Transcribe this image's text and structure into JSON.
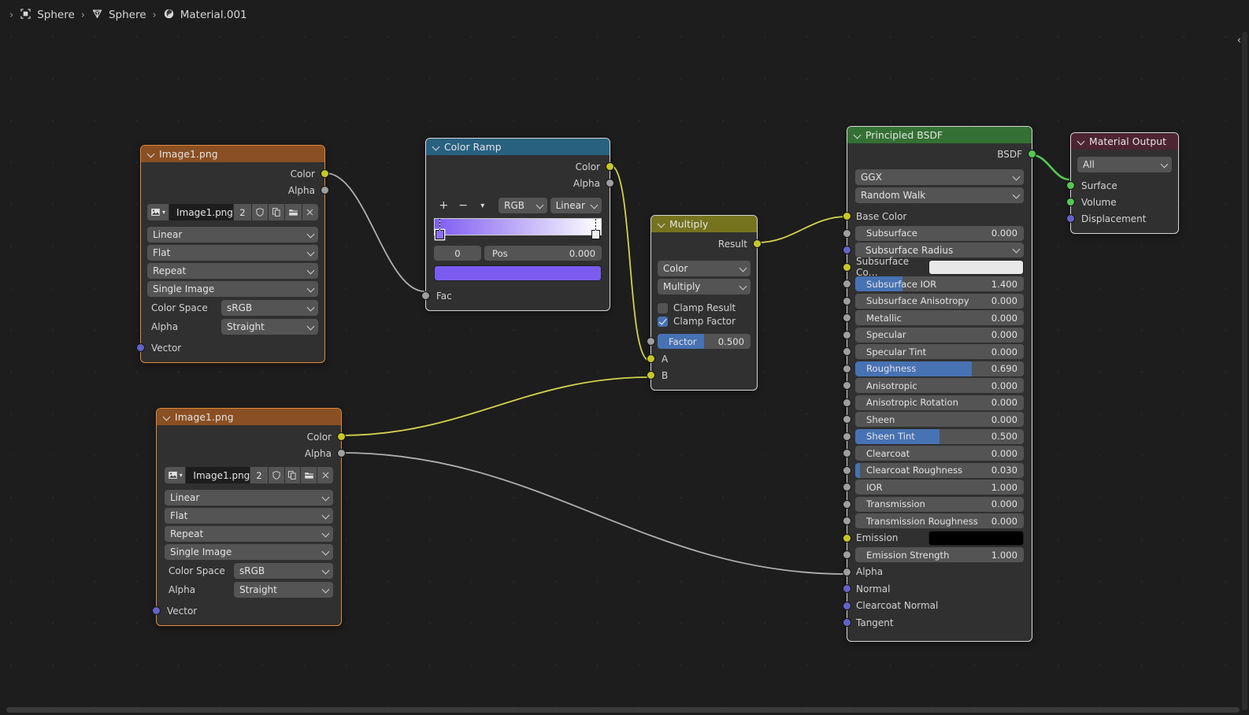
{
  "breadcrumb": {
    "items": [
      {
        "icon": "object-icon",
        "label": "Sphere"
      },
      {
        "icon": "mesh-data-icon",
        "label": "Sphere"
      },
      {
        "icon": "material-icon",
        "label": "Material.001"
      }
    ]
  },
  "colors": {
    "node_body": "#303030",
    "header_image": "#8a4f22",
    "header_colorramp": "#286180",
    "header_multiply": "#76731f",
    "header_bsdf": "#347034",
    "header_output": "#4d2431",
    "socket_color": "#c7c729",
    "socket_grey": "#9f9f9f",
    "socket_vector": "#6363c7",
    "socket_shader": "#57c754",
    "slider_fill": "#4772b3",
    "link_color": "#d2d24f",
    "link_grey": "#b0b0b0",
    "link_shader": "#57c754",
    "ramp_start": "#7d5cf2",
    "ramp_end": "#ffffff",
    "ramp_selected_color": "#7a5cf0",
    "subsurface_color_swatch": "#e8e8e8",
    "emission_swatch": "#000000"
  },
  "nodes": {
    "image_top": {
      "title": "Image1.png",
      "outputs": [
        {
          "name": "Color",
          "socket": "yellow"
        },
        {
          "name": "Alpha",
          "socket": "grey"
        }
      ],
      "datablock": {
        "browse_icon": "image-browse-icon",
        "name": "Image1.png",
        "users": "2",
        "shield_icon": "fake-user-icon",
        "copy_icon": "new-image-icon",
        "open_icon": "open-image-icon",
        "close_icon": "unlink-icon"
      },
      "dropdowns": [
        {
          "label": "Linear"
        },
        {
          "label": "Flat"
        },
        {
          "label": "Repeat"
        },
        {
          "label": "Single Image"
        }
      ],
      "props": [
        {
          "label": "Color Space",
          "value": "sRGB"
        },
        {
          "label": "Alpha",
          "value": "Straight"
        }
      ],
      "inputs": [
        {
          "name": "Vector",
          "socket": "violet"
        }
      ]
    },
    "image_bottom": {
      "title": "Image1.png",
      "outputs": [
        {
          "name": "Color",
          "socket": "yellow"
        },
        {
          "name": "Alpha",
          "socket": "grey"
        }
      ],
      "datablock": {
        "browse_icon": "image-browse-icon",
        "name": "Image1.png",
        "users": "2",
        "shield_icon": "fake-user-icon",
        "copy_icon": "new-image-icon",
        "open_icon": "open-image-icon",
        "close_icon": "unlink-icon"
      },
      "dropdowns": [
        {
          "label": "Linear"
        },
        {
          "label": "Flat"
        },
        {
          "label": "Repeat"
        },
        {
          "label": "Single Image"
        }
      ],
      "props": [
        {
          "label": "Color Space",
          "value": "sRGB"
        },
        {
          "label": "Alpha",
          "value": "Straight"
        }
      ],
      "inputs": [
        {
          "name": "Vector",
          "socket": "violet"
        }
      ]
    },
    "color_ramp": {
      "title": "Color Ramp",
      "outputs": [
        {
          "name": "Color",
          "socket": "yellow"
        },
        {
          "name": "Alpha",
          "socket": "grey"
        }
      ],
      "tools": {
        "add_label": "+",
        "remove_label": "−",
        "menu_icon": "chevron-down-icon",
        "interpolation_mode": "RGB",
        "interpolation_type": "Linear"
      },
      "stops": [
        {
          "index": "0",
          "pos": 0.0,
          "color": "#7d5cf2"
        },
        {
          "index": "1",
          "pos": 1.0,
          "color": "#ffffff"
        }
      ],
      "index_field": "0",
      "pos_label": "Pos",
      "pos_value": "0.000",
      "selected_color": "#7a5cf0",
      "inputs": [
        {
          "name": "Fac",
          "socket": "grey"
        }
      ]
    },
    "multiply": {
      "title": "Multiply",
      "outputs": [
        {
          "name": "Result",
          "socket": "yellow"
        }
      ],
      "data_type": "Color",
      "blend_mode": "Multiply",
      "clamp_result": {
        "label": "Clamp Result",
        "checked": false
      },
      "clamp_factor": {
        "label": "Clamp Factor",
        "checked": true
      },
      "factor": {
        "label": "Factor",
        "value": "0.500",
        "fill": 0.5,
        "socket": "grey"
      },
      "inputs": [
        {
          "name": "A",
          "socket": "yellow"
        },
        {
          "name": "B",
          "socket": "yellow"
        }
      ]
    },
    "principled_bsdf": {
      "title": "Principled BSDF",
      "outputs": [
        {
          "name": "BSDF",
          "socket": "green"
        }
      ],
      "distribution": "GGX",
      "subsurface_method": "Random Walk",
      "inputs": [
        {
          "name": "Base Color",
          "type": "label",
          "socket": "yellow"
        },
        {
          "name": "Subsurface",
          "type": "slider",
          "value": "0.000",
          "fill": 0.0,
          "socket": "grey"
        },
        {
          "name": "Subsurface Radius",
          "type": "dropdown",
          "socket": "violet"
        },
        {
          "name": "Subsurface Co…",
          "type": "swatch",
          "swatch": "#e8e8e8",
          "socket": "yellow"
        },
        {
          "name": "Subsurface IOR",
          "type": "slider",
          "value": "1.400",
          "fill": 0.28,
          "socket": "grey"
        },
        {
          "name": "Subsurface Anisotropy",
          "type": "slider",
          "value": "0.000",
          "fill": 0.0,
          "socket": "grey"
        },
        {
          "name": "Metallic",
          "type": "slider",
          "value": "0.000",
          "fill": 0.0,
          "socket": "grey"
        },
        {
          "name": "Specular",
          "type": "slider",
          "value": "0.000",
          "fill": 0.0,
          "socket": "grey"
        },
        {
          "name": "Specular Tint",
          "type": "slider",
          "value": "0.000",
          "fill": 0.0,
          "socket": "grey"
        },
        {
          "name": "Roughness",
          "type": "slider",
          "value": "0.690",
          "fill": 0.69,
          "socket": "grey"
        },
        {
          "name": "Anisotropic",
          "type": "slider",
          "value": "0.000",
          "fill": 0.0,
          "socket": "grey"
        },
        {
          "name": "Anisotropic Rotation",
          "type": "slider",
          "value": "0.000",
          "fill": 0.0,
          "socket": "grey"
        },
        {
          "name": "Sheen",
          "type": "slider",
          "value": "0.000",
          "fill": 0.0,
          "socket": "grey"
        },
        {
          "name": "Sheen Tint",
          "type": "slider",
          "value": "0.500",
          "fill": 0.5,
          "socket": "grey"
        },
        {
          "name": "Clearcoat",
          "type": "slider",
          "value": "0.000",
          "fill": 0.0,
          "socket": "grey"
        },
        {
          "name": "Clearcoat Roughness",
          "type": "slider",
          "value": "0.030",
          "fill": 0.03,
          "socket": "grey"
        },
        {
          "name": "IOR",
          "type": "slider",
          "value": "1.000",
          "fill": 0.0,
          "socket": "grey"
        },
        {
          "name": "Transmission",
          "type": "slider",
          "value": "0.000",
          "fill": 0.0,
          "socket": "grey"
        },
        {
          "name": "Transmission Roughness",
          "type": "slider",
          "value": "0.000",
          "fill": 0.0,
          "socket": "grey"
        },
        {
          "name": "Emission",
          "type": "swatch",
          "swatch": "#000000",
          "socket": "yellow"
        },
        {
          "name": "Emission Strength",
          "type": "slider",
          "value": "1.000",
          "fill": 0.0,
          "socket": "grey"
        },
        {
          "name": "Alpha",
          "type": "label",
          "socket": "grey"
        },
        {
          "name": "Normal",
          "type": "label",
          "socket": "violet"
        },
        {
          "name": "Clearcoat Normal",
          "type": "label",
          "socket": "violet"
        },
        {
          "name": "Tangent",
          "type": "label",
          "socket": "violet"
        }
      ]
    },
    "material_output": {
      "title": "Material Output",
      "target": "All",
      "inputs": [
        {
          "name": "Surface",
          "socket": "green"
        },
        {
          "name": "Volume",
          "socket": "green"
        },
        {
          "name": "Displacement",
          "socket": "violet"
        }
      ]
    }
  },
  "links": [
    {
      "from": "image_top.Color",
      "to": "color_ramp.Fac",
      "color": "#b0b0b0"
    },
    {
      "from": "color_ramp.Color",
      "to": "multiply.A",
      "color": "#d2d24f"
    },
    {
      "from": "image_bottom.Color",
      "to": "multiply.B",
      "color": "#d2d24f"
    },
    {
      "from": "multiply.Result",
      "to": "principled_bsdf.Base Color",
      "color": "#d2d24f"
    },
    {
      "from": "image_bottom.Alpha",
      "to": "principled_bsdf.Alpha",
      "color": "#b0b0b0"
    },
    {
      "from": "principled_bsdf.BSDF",
      "to": "material_output.Surface",
      "color": "#57c754"
    }
  ],
  "scrollbars": {
    "vertical_visible": true,
    "horizontal_visible": true,
    "collapse_arrow": "chevron-left-icon"
  }
}
